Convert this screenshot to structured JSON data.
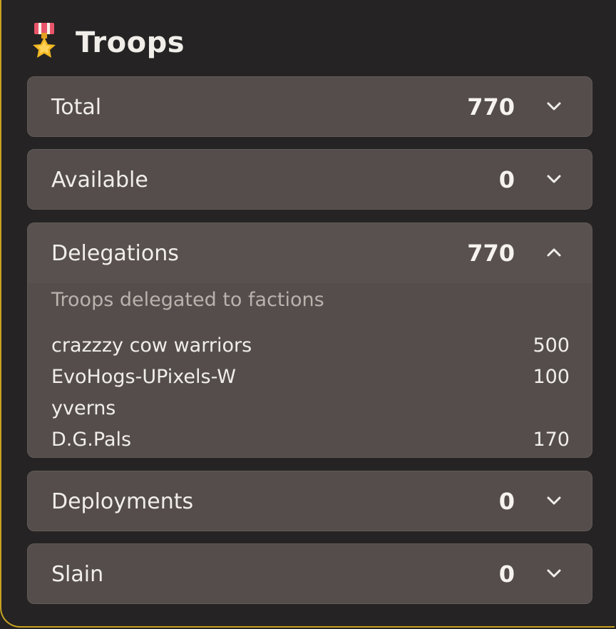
{
  "panel": {
    "title": "Troops",
    "icon": "medal-icon"
  },
  "rows": {
    "total": {
      "label": "Total",
      "value": "770",
      "expanded": false
    },
    "available": {
      "label": "Available",
      "value": "0",
      "expanded": false
    },
    "delegations": {
      "label": "Delegations",
      "value": "770",
      "expanded": true,
      "subtitle": "Troops delegated to factions",
      "factions": [
        {
          "name": "crazzzy cow warriors",
          "count": "500"
        },
        {
          "name": "EvoHogs-UPixels-Wyverns",
          "count": "100"
        },
        {
          "name": "D.G.Pals",
          "count": "170"
        }
      ]
    },
    "deployments": {
      "label": "Deployments",
      "value": "0",
      "expanded": false
    },
    "slain": {
      "label": "Slain",
      "value": "0",
      "expanded": false
    }
  },
  "colors": {
    "background": "#252323",
    "card": "#544d4b",
    "accent_border": "#c9a322",
    "text": "#f1eeea",
    "muted_text": "#b9b2ad"
  }
}
